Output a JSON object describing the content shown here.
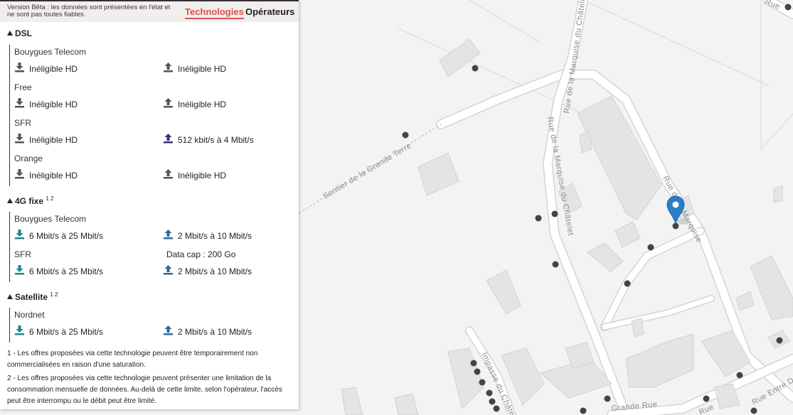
{
  "header": {
    "beta_notice": "Version Bêta : les données sont présentées en l'état et ne sont pas toutes fiables.",
    "tabs": [
      "Technologies",
      "Opérateurs"
    ],
    "active_tab": "Technologies"
  },
  "colors": {
    "accent": "#d9534f",
    "icon_grey": "#555555",
    "icon_teal": "#1a8a8a",
    "icon_purple": "#3b2d7a",
    "icon_blue": "#2a6a9a",
    "marker": "#2a7ec8"
  },
  "dsl": {
    "title": "DSL",
    "operators": [
      {
        "name": "Bouygues Telecom",
        "down": "Inéligible HD",
        "up": "Inéligible HD",
        "down_icon": "download-icon",
        "up_icon": "upload-icon"
      },
      {
        "name": "Free",
        "down": "Inéligible HD",
        "up": "Inéligible HD",
        "down_icon": "download-icon",
        "up_icon": "upload-icon"
      },
      {
        "name": "SFR",
        "down": "Inéligible HD",
        "up": "512 kbit/s à 4 Mbit/s",
        "down_icon": "download-icon",
        "up_icon": "upload-icon"
      },
      {
        "name": "Orange",
        "down": "Inéligible HD",
        "up": "Inéligible HD",
        "down_icon": "download-icon",
        "up_icon": "upload-icon"
      }
    ]
  },
  "fixed4g": {
    "title": "4G fixe",
    "notes": "1 2",
    "operators": [
      {
        "name": "Bouygues Telecom",
        "down": "6 Mbit/s à 25 Mbit/s",
        "up": "2 Mbit/s à 10 Mbit/s"
      },
      {
        "name": "SFR",
        "data_cap": "Data cap : 200 Go",
        "down": "6 Mbit/s à 25 Mbit/s",
        "up": "2 Mbit/s à 10 Mbit/s"
      }
    ]
  },
  "satellite": {
    "title": "Satellite",
    "notes": "1 2",
    "operators": [
      {
        "name": "Nordnet",
        "down": "6 Mbit/s à 25 Mbit/s",
        "up": "2 Mbit/s à 10 Mbit/s"
      }
    ]
  },
  "footnotes": [
    "1 - Les offres proposées via cette technologie peuvent être temporairement non commercialisées en raison d'une saturation.",
    "2 - Les offres proposées via cette technologie peuvent présenter une limitation de la consommation mensuelle de données. Au-delà de cette limite, selon l'opérateur, l'accès peut être interrompu ou le débit peut être limité."
  ],
  "map": {
    "street_labels": [
      "Sentier de la Grande Terre",
      "Rue de la Marquise du Châtelet",
      "Rue de la Marquise du Châtelet",
      "Impasse du Châtelet",
      "Grande Rue",
      "Rue",
      "Rue Entre Deux",
      "Rue de la Marquise",
      "Rue"
    ]
  }
}
